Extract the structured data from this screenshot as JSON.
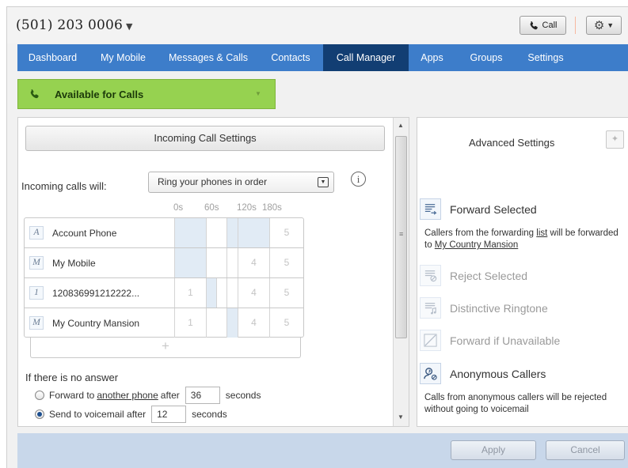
{
  "header": {
    "phone_number": "(501) 203 0006",
    "call_label": "Call"
  },
  "nav": {
    "items": [
      {
        "label": "Dashboard",
        "active": false
      },
      {
        "label": "My Mobile",
        "active": false
      },
      {
        "label": "Messages & Calls",
        "active": false
      },
      {
        "label": "Contacts",
        "active": false
      },
      {
        "label": "Call Manager",
        "active": true
      },
      {
        "label": "Apps",
        "active": false
      },
      {
        "label": "Groups",
        "active": false
      },
      {
        "label": "Settings",
        "active": false
      }
    ]
  },
  "status": {
    "label": "Available for Calls",
    "color": "#96d250"
  },
  "incoming": {
    "title": "Incoming Call Settings",
    "calls_will_label": "Incoming calls will:",
    "mode_value": "Ring your phones in order",
    "time_labels": [
      "0s",
      "60s",
      "120s",
      "180s"
    ],
    "phones": [
      {
        "badge": "A",
        "name": "Account Phone",
        "cells": [
          "",
          "",
          "",
          "",
          "5"
        ]
      },
      {
        "badge": "M",
        "name": "My Mobile",
        "cells": [
          "",
          "",
          "",
          "4",
          "5"
        ]
      },
      {
        "badge": "1",
        "name": "120836991212222...",
        "cells": [
          "1",
          "",
          "",
          "4",
          "5"
        ]
      },
      {
        "badge": "M",
        "name": "My Country Mansion",
        "cells": [
          "1",
          "",
          "",
          "4",
          "5"
        ]
      }
    ],
    "add_symbol": "+",
    "no_answer": {
      "title": "If there is no answer",
      "forward_prefix": "Forward to",
      "forward_link": "another phone",
      "forward_after": "after",
      "forward_seconds": "36",
      "forward_unit": "seconds",
      "voicemail_text": "Send to voicemail after",
      "voicemail_seconds": "12",
      "voicemail_unit": "seconds"
    }
  },
  "advanced": {
    "title": "Advanced Settings",
    "forward_selected": {
      "label": "Forward Selected",
      "desc_1": "Callers from the forwarding",
      "desc_link": "list",
      "desc_2": "will be forwarded to",
      "desc_target": "My Country Mansion"
    },
    "reject_selected": "Reject Selected",
    "distinctive_ringtone": "Distinctive Ringtone",
    "forward_unavailable": "Forward if Unavailable",
    "anonymous": {
      "label": "Anonymous Callers",
      "desc": "Calls from anonymous callers will be rejected without going to voicemail"
    }
  },
  "footer": {
    "apply": "Apply",
    "cancel": "Cancel"
  },
  "colors": {
    "nav_bg": "#3d7dca",
    "nav_active": "#123e73",
    "footer_bg": "#c8d7ea"
  }
}
